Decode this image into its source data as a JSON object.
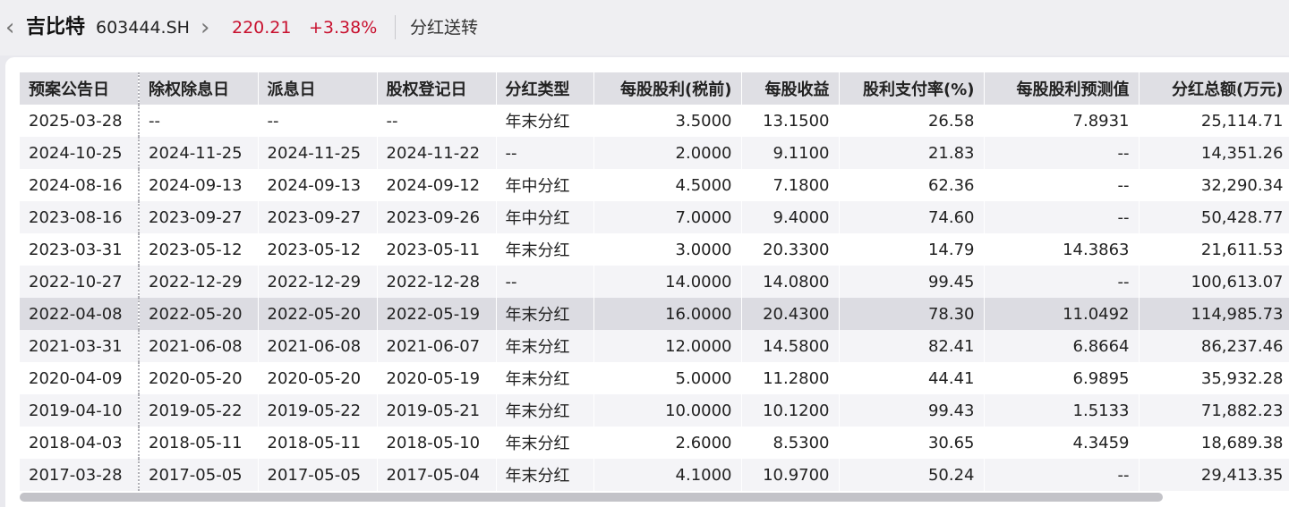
{
  "header": {
    "stock_name": "吉比特",
    "stock_code": "603444.SH",
    "price": "220.21",
    "change": "+3.38%",
    "section_title": "分红送转",
    "back_icon": "‹",
    "forward_icon": "›",
    "up_color": "#c8102e"
  },
  "table": {
    "columns": [
      "预案公告日",
      "除权除息日",
      "派息日",
      "股权登记日",
      "分红类型",
      "每股股利(税前)",
      "每股收益",
      "股利支付率(%)",
      "每股股利预测值",
      "分红总额(万元)"
    ],
    "rows": [
      [
        "2025-03-28",
        "--",
        "--",
        "--",
        "年末分红",
        "3.5000",
        "13.1500",
        "26.58",
        "7.8931",
        "25,114.71"
      ],
      [
        "2024-10-25",
        "2024-11-25",
        "2024-11-25",
        "2024-11-22",
        "--",
        "2.0000",
        "9.1100",
        "21.83",
        "--",
        "14,351.26"
      ],
      [
        "2024-08-16",
        "2024-09-13",
        "2024-09-13",
        "2024-09-12",
        "年中分红",
        "4.5000",
        "7.1800",
        "62.36",
        "--",
        "32,290.34"
      ],
      [
        "2023-08-16",
        "2023-09-27",
        "2023-09-27",
        "2023-09-26",
        "年中分红",
        "7.0000",
        "9.4000",
        "74.60",
        "--",
        "50,428.77"
      ],
      [
        "2023-03-31",
        "2023-05-12",
        "2023-05-12",
        "2023-05-11",
        "年末分红",
        "3.0000",
        "20.3300",
        "14.79",
        "14.3863",
        "21,611.53"
      ],
      [
        "2022-10-27",
        "2022-12-29",
        "2022-12-29",
        "2022-12-28",
        "--",
        "14.0000",
        "14.0800",
        "99.45",
        "--",
        "100,613.07"
      ],
      [
        "2022-04-08",
        "2022-05-20",
        "2022-05-20",
        "2022-05-19",
        "年末分红",
        "16.0000",
        "20.4300",
        "78.30",
        "11.0492",
        "114,985.73"
      ],
      [
        "2021-03-31",
        "2021-06-08",
        "2021-06-08",
        "2021-06-07",
        "年末分红",
        "12.0000",
        "14.5800",
        "82.41",
        "6.8664",
        "86,237.46"
      ],
      [
        "2020-04-09",
        "2020-05-20",
        "2020-05-20",
        "2020-05-19",
        "年末分红",
        "5.0000",
        "11.2800",
        "44.41",
        "6.9895",
        "35,932.28"
      ],
      [
        "2019-04-10",
        "2019-05-22",
        "2019-05-22",
        "2019-05-21",
        "年末分红",
        "10.0000",
        "10.1200",
        "99.43",
        "1.5133",
        "71,882.23"
      ],
      [
        "2018-04-03",
        "2018-05-11",
        "2018-05-11",
        "2018-05-10",
        "年末分红",
        "2.6000",
        "8.5300",
        "30.65",
        "4.3459",
        "18,689.38"
      ],
      [
        "2017-03-28",
        "2017-05-05",
        "2017-05-05",
        "2017-05-04",
        "年末分红",
        "4.1000",
        "10.9700",
        "50.24",
        "--",
        "29,413.35"
      ]
    ],
    "selected_row_index": 6
  }
}
